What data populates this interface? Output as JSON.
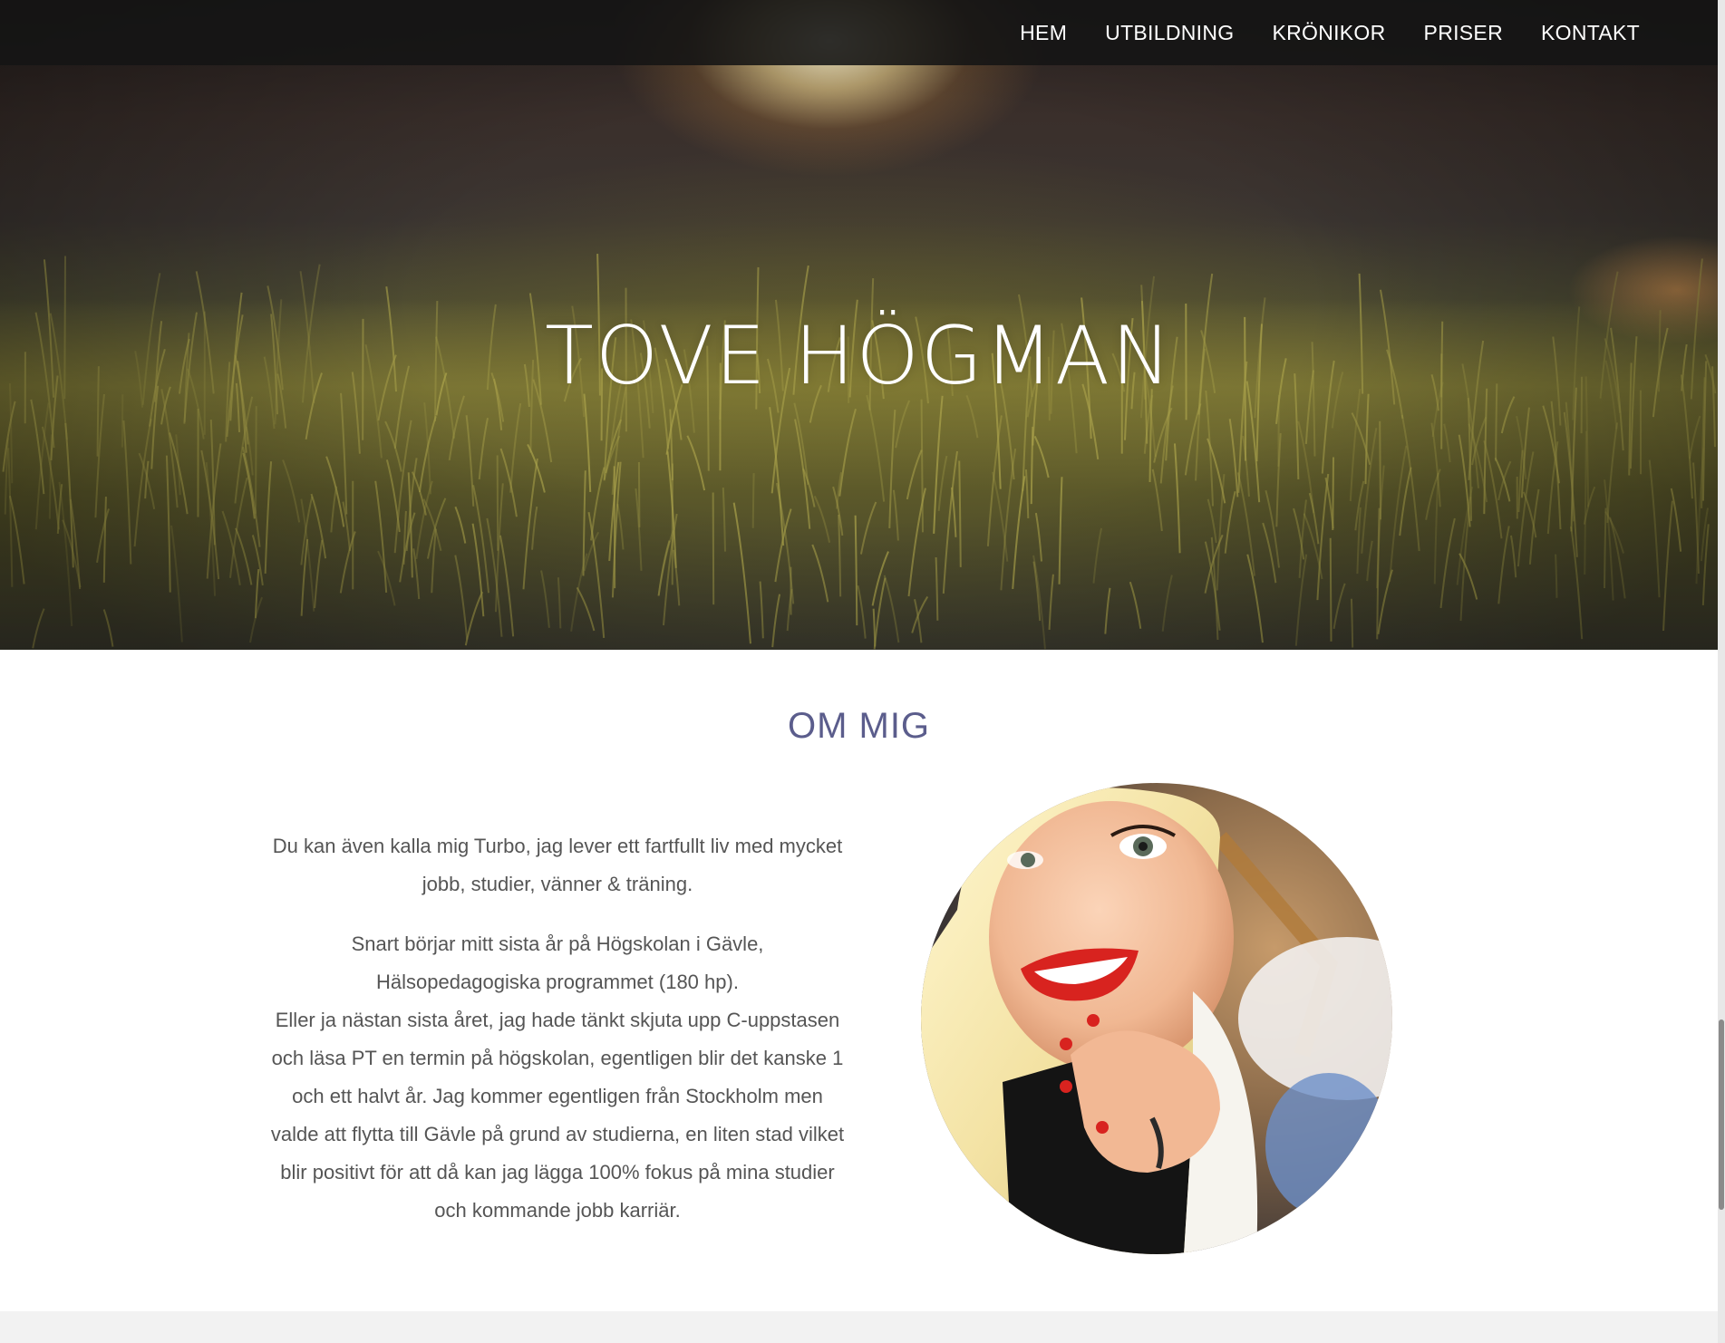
{
  "nav": {
    "items": [
      {
        "label": "HEM"
      },
      {
        "label": "UTBILDNING"
      },
      {
        "label": "KRÖNIKOR"
      },
      {
        "label": "PRISER"
      },
      {
        "label": "KONTAKT"
      }
    ]
  },
  "hero": {
    "title": "TOVE HÖGMAN"
  },
  "about": {
    "heading": "OM MIG",
    "paragraph1": [
      "Du kan även kalla mig Turbo, jag lever ett fartfullt liv med mycket",
      "jobb, studier, vänner & träning."
    ],
    "paragraph2": [
      "Snart börjar mitt sista år på Högskolan i Gävle,",
      "Hälsopedagogiska programmet (180 hp).",
      "Eller ja nästan sista året, jag hade tänkt skjuta upp C-uppstasen",
      "och läsa PT en termin på högskolan, egentligen blir det kanske 1",
      "och ett halvt år. Jag kommer egentligen från Stockholm men",
      "valde att flytta till Gävle på grund av studierna, en liten stad vilket",
      "blir positivt för att då kan jag lägga 100% fokus på mina studier",
      "och kommande jobb karriär."
    ]
  },
  "colors": {
    "navbar": "#141414",
    "heading": "#5b5d8c",
    "body_text": "#555555",
    "footer_strip": "#f2f2f2"
  }
}
